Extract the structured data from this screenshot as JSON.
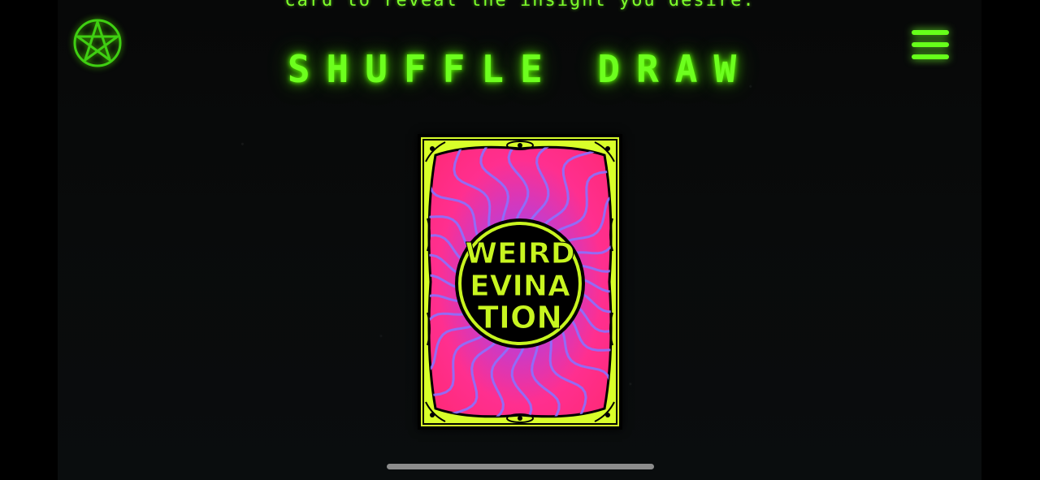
{
  "header": {
    "instruction_text": "card to reveal the insight you desire.",
    "title": "SHUFFLE DRAW"
  },
  "icons": {
    "logo": "pentagram-icon",
    "menu": "hamburger-menu-icon"
  },
  "card": {
    "name": "tarot-card-back",
    "emblem_line_1": "WEIRD",
    "emblem_line_2": "EVINA",
    "emblem_line_3": "TION"
  },
  "colors": {
    "neon_green": "#66ff1a",
    "card_pink": "#ff2f8f",
    "card_violet": "#8f5cff",
    "card_lime": "#d8ff2a",
    "background": "#000000"
  }
}
